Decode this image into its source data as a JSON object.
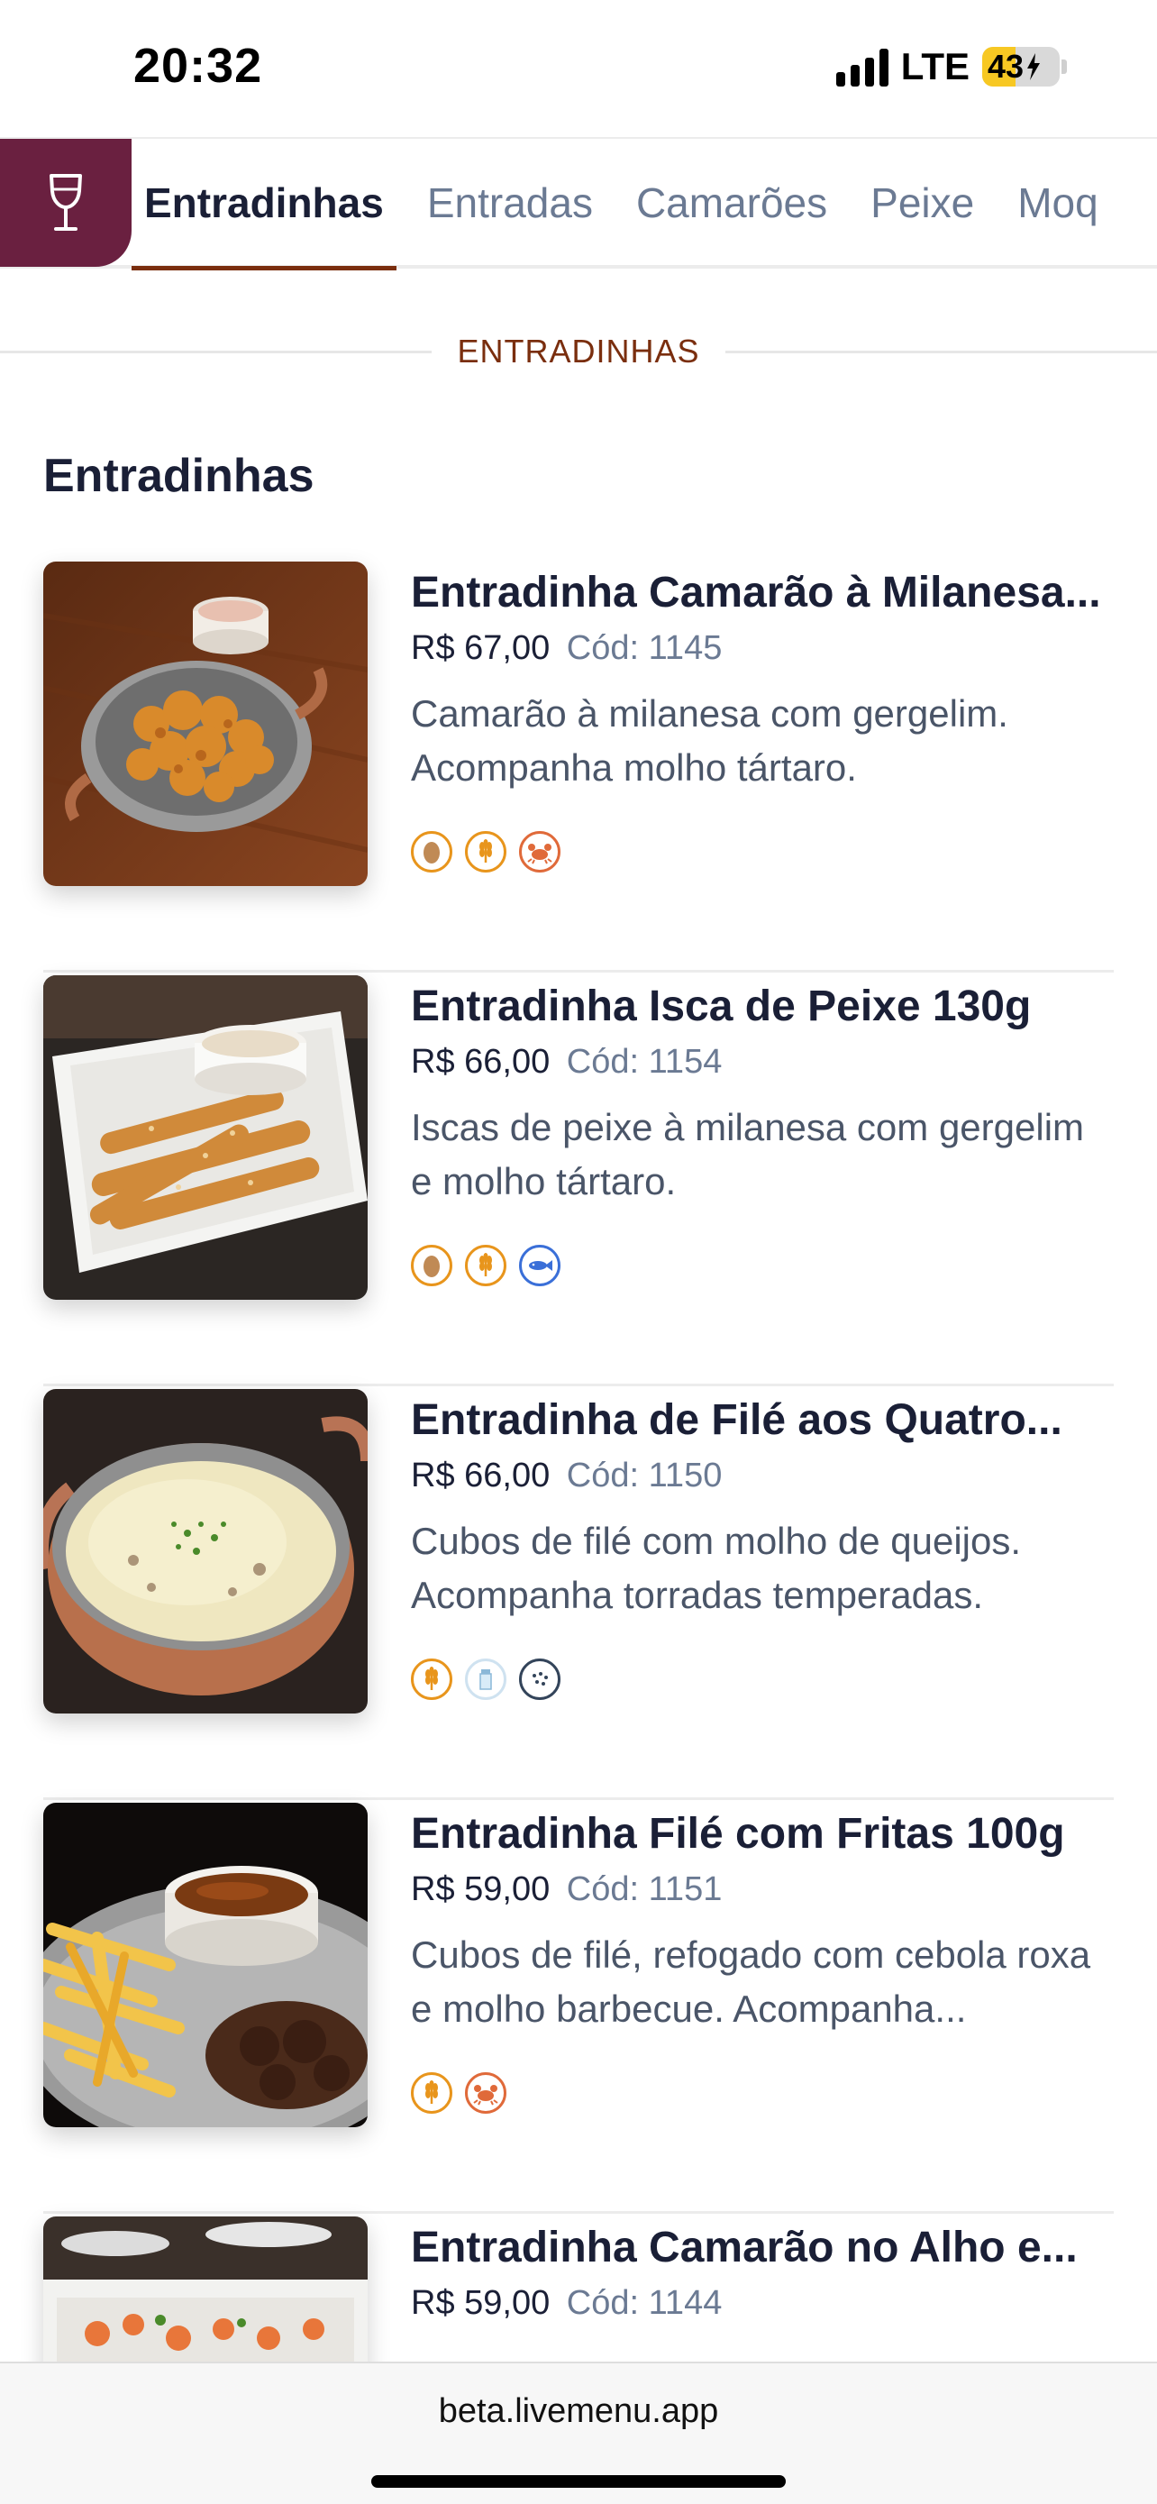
{
  "status_bar": {
    "time": "20:32",
    "network": "LTE",
    "battery": "43",
    "battery_level": 0.43
  },
  "tabs": [
    {
      "label": "Entradinhas",
      "active": true
    },
    {
      "label": "Entradas",
      "active": false
    },
    {
      "label": "Camarões",
      "active": false
    },
    {
      "label": "Peixe",
      "active": false
    },
    {
      "label": "Moq",
      "active": false
    }
  ],
  "section": {
    "divider_label": "ENTRADINHAS",
    "title": "Entradinhas"
  },
  "items": [
    {
      "name": "Entradinha Camarão à Milanesa...",
      "price": "R$ 67,00",
      "code": "Cód: 1145",
      "description": "Camarão à milanesa com gergelim. Acompanha molho tártaro.",
      "allergens": [
        "egg-icon",
        "wheat-icon",
        "crab-icon"
      ]
    },
    {
      "name": "Entradinha Isca de Peixe 130g",
      "price": "R$ 66,00",
      "code": "Cód: 1154",
      "description": "Iscas de peixe à milanesa com gergelim e molho tártaro.",
      "allergens": [
        "egg-icon",
        "wheat-icon",
        "fish-icon"
      ]
    },
    {
      "name": "Entradinha de Filé aos Quatro...",
      "price": "R$ 66,00",
      "code": "Cód: 1150",
      "description": "Cubos de filé com molho de queijos. Acompanha torradas temperadas.",
      "allergens": [
        "wheat-icon",
        "milk-icon",
        "lactose-icon"
      ]
    },
    {
      "name": "Entradinha Filé com Fritas 100g",
      "price": "R$ 59,00",
      "code": "Cód: 1151",
      "description": "Cubos de filé, refogado com cebola roxa e molho barbecue. Acompanha...",
      "allergens": [
        "wheat-icon",
        "crab-icon"
      ]
    },
    {
      "name": "Entradinha Camarão no Alho e...",
      "price": "R$ 59,00",
      "code": "Cód: 1144",
      "description": "",
      "allergens": []
    }
  ],
  "browser": {
    "url": "beta.livemenu.app"
  },
  "colors": {
    "brand": "#6a2040",
    "accent": "#7a2e0e",
    "muted_text": "#6b7a93"
  }
}
